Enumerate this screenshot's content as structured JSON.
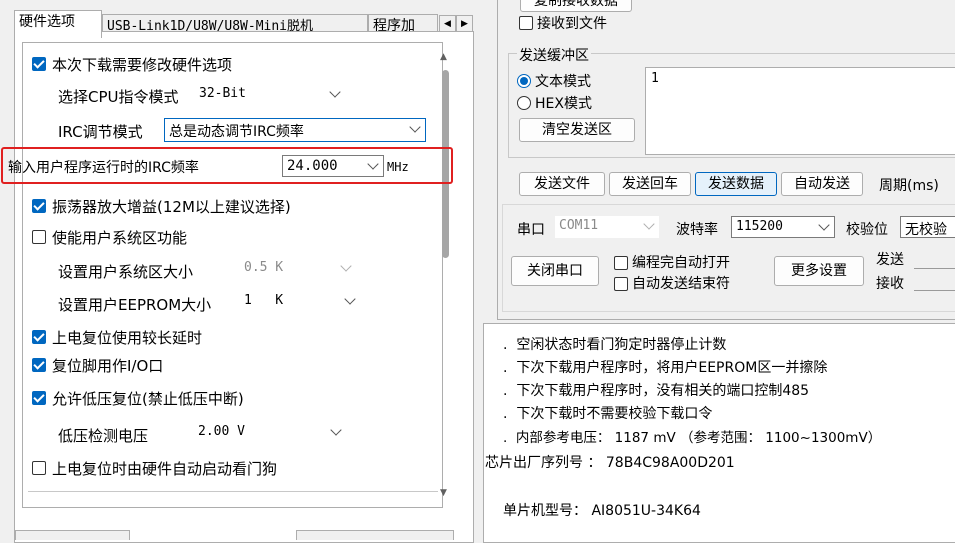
{
  "tabs": [
    {
      "label": "硬件选项",
      "active": true
    },
    {
      "label": "USB-Link1D/U8W/U8W-Mini脱机",
      "active": false
    },
    {
      "label": "程序加",
      "active": false
    }
  ],
  "tab_scroll": {
    "left": "◀",
    "right": "▶"
  },
  "hardware": {
    "items": [
      {
        "label": "本次下载需要修改硬件选项",
        "checked": true
      },
      {
        "label": "选择CPU指令模式",
        "value": "32-Bit"
      },
      {
        "label": "IRC调节模式",
        "value": "总是动态调节IRC频率"
      },
      {
        "label": "输入用户程序运行时的IRC频率",
        "value": "24.000",
        "unit": "MHz"
      },
      {
        "label": "振荡器放大增益(12M以上建议选择)",
        "checked": true
      },
      {
        "label": "使能用户系统区功能",
        "checked": false
      },
      {
        "label": "设置用户系统区大小",
        "value": "0.5 K"
      },
      {
        "label": "设置用户EEPROM大小",
        "value": "1   K"
      },
      {
        "label": "上电复位使用较长延时",
        "checked": true
      },
      {
        "label": "复位脚用作I/O口",
        "checked": true
      },
      {
        "label": "允许低压复位(禁止低压中断)",
        "checked": true
      },
      {
        "label": "低压检测电压",
        "value": "2.00 V"
      },
      {
        "label": "上电复位时由硬件自动启动看门狗",
        "checked": false
      }
    ]
  },
  "receive": {
    "copy_button": "复制接收数据",
    "save_to_file": "接收到文件"
  },
  "send_buffer": {
    "group_label": "发送缓冲区",
    "text_mode": "文本模式",
    "hex_mode": "HEX模式",
    "clear_button": "清空发送区",
    "content": "1"
  },
  "send_actions": {
    "send_file": "发送文件",
    "send_return": "发送回车",
    "send_data": "发送数据",
    "auto_send": "自动发送",
    "period": "周期(ms)"
  },
  "serial": {
    "port_label": "串口",
    "port_value": "COM11",
    "baud_label": "波特率",
    "baud_value": "115200",
    "parity_label": "校验位",
    "parity_value": "无校验",
    "close_button": "关闭串口",
    "auto_open": "编程完自动打开",
    "auto_send_end": "自动发送结束符",
    "more_settings": "更多设置",
    "send_label": "发送",
    "recv_label": "接收"
  },
  "log": {
    "lines": [
      "空闲状态时看门狗定时器停止计数",
      "下次下载用户程序时，将用户EEPROM区一并擦除",
      "下次下载用户程序时，没有相关的端口控制485",
      "下次下载时不需要校验下载口令",
      "内部参考电压： 1187 mV （参考范围： 1100~1300mV）"
    ],
    "serial_label": "芯片出厂序列号 ： 78B4C98A00D201",
    "model_label": "单片机型号： AI8051U-34K64"
  },
  "colors": {
    "accent": "#0067c0",
    "highlight": "#e02020"
  }
}
